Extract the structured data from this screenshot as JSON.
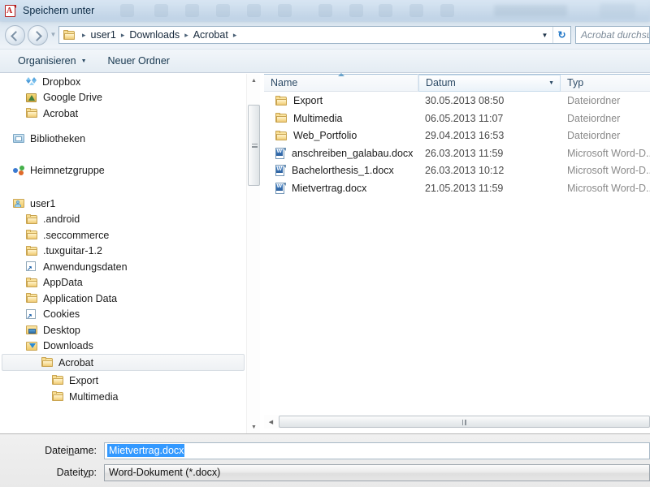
{
  "window": {
    "title": "Speichern unter",
    "app_icon": "acrobat-pdf-icon"
  },
  "addressbar": {
    "back_icon": "back-arrow-icon",
    "forward_icon": "forward-arrow-icon",
    "recent_icon": "chevron-down-icon",
    "folder_icon": "folder-icon",
    "separator": "▸",
    "crumbs": [
      "user1",
      "Downloads",
      "Acrobat"
    ],
    "dropdown_icon": "chevron-down-icon",
    "refresh_icon": "refresh-icon",
    "refresh_glyph": "↻"
  },
  "search": {
    "placeholder": "Acrobat durchsuchen",
    "icon": "search-icon"
  },
  "toolbar": {
    "organize_label": "Organisieren",
    "organize_caret": "▼",
    "new_folder_label": "Neuer Ordner"
  },
  "tree": {
    "items": [
      {
        "label": "Dropbox",
        "icon": "dropbox-icon",
        "indent": 1,
        "selected": false
      },
      {
        "label": "Google Drive",
        "icon": "gdrive-icon",
        "indent": 1,
        "selected": false
      },
      {
        "label": "Acrobat",
        "icon": "folder-icon",
        "indent": 1,
        "selected": false
      },
      {
        "label": "Bibliotheken",
        "icon": "library-icon",
        "indent": 0,
        "selected": false
      },
      {
        "label": "Heimnetzgruppe",
        "icon": "homegroup-icon",
        "indent": 0,
        "selected": false
      },
      {
        "label": "user1",
        "icon": "user-folder-icon",
        "indent": 0,
        "selected": false
      },
      {
        "label": ".android",
        "icon": "folder-icon",
        "indent": 1,
        "selected": false
      },
      {
        "label": ".seccommerce",
        "icon": "folder-icon",
        "indent": 1,
        "selected": false
      },
      {
        "label": ".tuxguitar-1.2",
        "icon": "folder-icon",
        "indent": 1,
        "selected": false
      },
      {
        "label": "Anwendungsdaten",
        "icon": "shortcut-icon",
        "indent": 1,
        "selected": false
      },
      {
        "label": "AppData",
        "icon": "folder-icon",
        "indent": 1,
        "selected": false
      },
      {
        "label": "Application Data",
        "icon": "folder-icon",
        "indent": 1,
        "selected": false
      },
      {
        "label": "Cookies",
        "icon": "shortcut-icon",
        "indent": 1,
        "selected": false
      },
      {
        "label": "Desktop",
        "icon": "desktop-folder-icon",
        "indent": 1,
        "selected": false
      },
      {
        "label": "Downloads",
        "icon": "downloads-folder-icon",
        "indent": 1,
        "selected": false
      },
      {
        "label": "Acrobat",
        "icon": "folder-icon",
        "indent": 2,
        "selected": true
      },
      {
        "label": "Export",
        "icon": "folder-icon",
        "indent": 3,
        "selected": false
      },
      {
        "label": "Multimedia",
        "icon": "folder-icon",
        "indent": 3,
        "selected": false
      }
    ],
    "scroll_up_icon": "triangle-up-icon",
    "scroll_down_icon": "triangle-down-icon"
  },
  "filelist": {
    "columns": [
      {
        "key": "name",
        "label": "Name",
        "sorted": true,
        "sort_direction": "asc",
        "active": false
      },
      {
        "key": "date",
        "label": "Datum",
        "sorted": false,
        "sort_direction": "",
        "active": true
      },
      {
        "key": "type",
        "label": "Typ",
        "sorted": false,
        "sort_direction": "",
        "active": false
      }
    ],
    "rows": [
      {
        "name": "Export",
        "icon": "folder-icon",
        "date": "30.05.2013 08:50",
        "type": "Dateiordner"
      },
      {
        "name": "Multimedia",
        "icon": "folder-icon",
        "date": "06.05.2013 11:07",
        "type": "Dateiordner"
      },
      {
        "name": "Web_Portfolio",
        "icon": "folder-icon",
        "date": "29.04.2013 16:53",
        "type": "Dateiordner"
      },
      {
        "name": "anschreiben_galabau.docx",
        "icon": "word-doc-icon",
        "date": "26.03.2013 11:59",
        "type": "Microsoft Word-D..."
      },
      {
        "name": "Bachelorthesis_1.docx",
        "icon": "word-doc-icon",
        "date": "26.03.2013 10:12",
        "type": "Microsoft Word-D..."
      },
      {
        "name": "Mietvertrag.docx",
        "icon": "word-doc-icon",
        "date": "21.05.2013 11:59",
        "type": "Microsoft Word-D..."
      }
    ],
    "hscroll_left_icon": "triangle-left-icon"
  },
  "form": {
    "filename_label": "Dateiname:",
    "filename_value": "Mietvertrag.docx",
    "filename_selected": true,
    "filetype_label": "Dateityp:",
    "filetype_value": "Word-Dokument (*.docx)"
  },
  "colors": {
    "selection_blue": "#3399ff",
    "title_text": "#0b2a45",
    "window_chrome": "#dbe6f0"
  }
}
